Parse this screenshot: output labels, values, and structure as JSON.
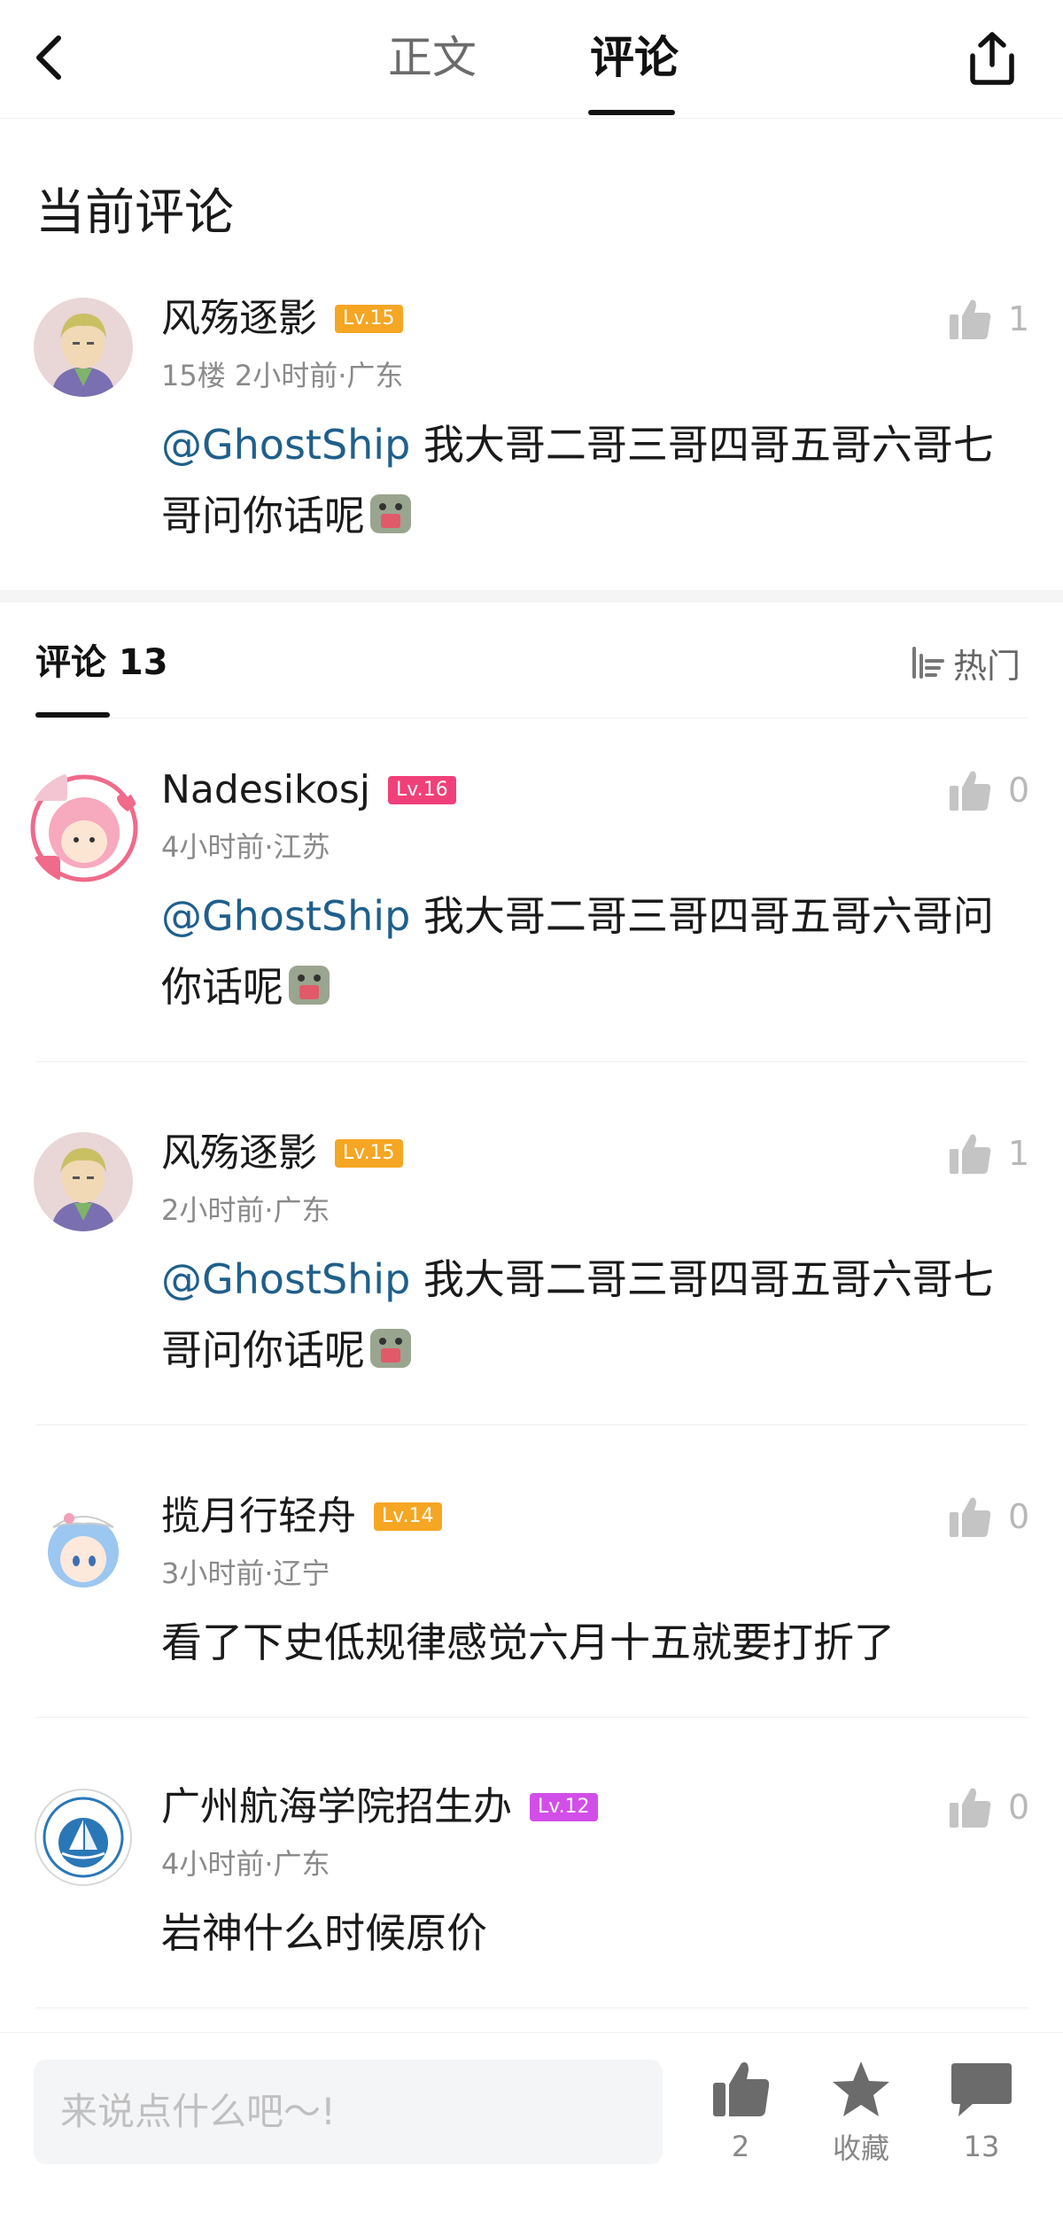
{
  "tabs": {
    "body": "正文",
    "comments": "评论"
  },
  "current_section": {
    "title": "当前评论"
  },
  "current_comment": {
    "username": "风殇逐影",
    "level": "Lv.15",
    "meta": "15楼 2小时前·广东",
    "mention": "@GhostShip",
    "text": " 我大哥二哥三哥四哥五哥六哥七哥问你话呢",
    "likes": "1"
  },
  "list_header": {
    "title": "评论 13",
    "sort_label": "热门"
  },
  "comments": [
    {
      "username": "Nadesikosj",
      "level": "Lv.16",
      "meta": "4小时前·江苏",
      "mention": "@GhostShip",
      "text": " 我大哥二哥三哥四哥五哥六哥问你话呢",
      "likes": "0"
    },
    {
      "username": "风殇逐影",
      "level": "Lv.15",
      "meta": "2小时前·广东",
      "mention": "@GhostShip",
      "text": " 我大哥二哥三哥四哥五哥六哥七哥问你话呢",
      "likes": "1"
    },
    {
      "username": "揽月行轻舟",
      "level": "Lv.14",
      "meta": "3小时前·辽宁",
      "mention": "",
      "text": "看了下史低规律感觉六月十五就要打折了",
      "likes": "0"
    },
    {
      "username": "广州航海学院招生办",
      "level": "Lv.12",
      "meta": "4小时前·广东",
      "mention": "",
      "text": "岩神什么时候原价",
      "likes": "0"
    }
  ],
  "bottom_bar": {
    "input_placeholder": "来说点什么吧～!",
    "like_count": "2",
    "favorite_label": "收藏",
    "comment_count": "13"
  },
  "colors": {
    "lv15": "#f5a623",
    "lv16": "#f0407a",
    "lv14": "#f5a623",
    "lv12": "#d24ee8",
    "mention": "#1f5f8b"
  }
}
